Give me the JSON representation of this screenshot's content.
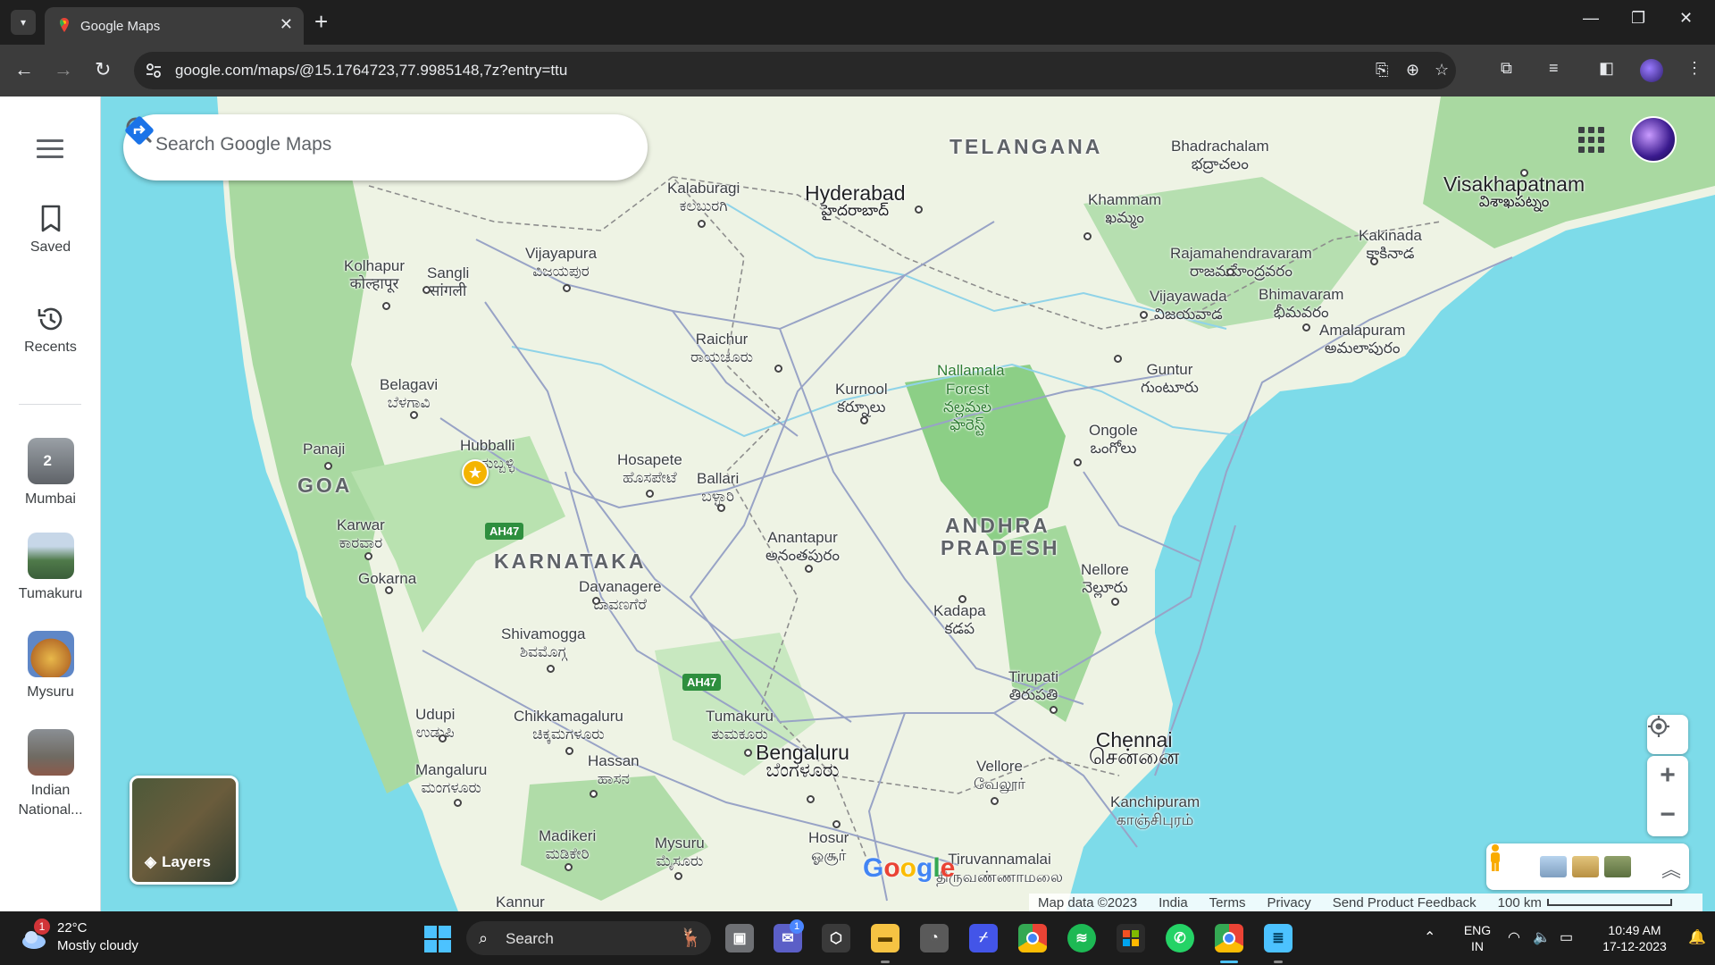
{
  "browser": {
    "tab_title": "Google Maps",
    "url": "google.com/maps/@15.1764723,77.9985148,7z?entry=ttu"
  },
  "sidebar": {
    "saved": "Saved",
    "recents": "Recents",
    "recent_places": [
      {
        "label": "Mumbai",
        "badge": "2"
      },
      {
        "label": "Tumakuru"
      },
      {
        "label": "Mysuru"
      },
      {
        "label": "Indian National..."
      }
    ]
  },
  "search": {
    "placeholder": "Search Google Maps"
  },
  "map": {
    "states": [
      "TELANGANA",
      "KARNATAKA",
      "ANDHRA",
      "PRADESH",
      "GOA"
    ],
    "places": [
      {
        "name": "Hyderabad",
        "local": "హైదరాబాద్"
      },
      {
        "name": "Kalaburagi",
        "local": "ಕಲಬುರಗಿ"
      },
      {
        "name": "Vijayapura",
        "local": "ವಿಜಯಪುರ"
      },
      {
        "name": "Kolhapur",
        "local": "कोल्हापूर"
      },
      {
        "name": "Sangli",
        "local": "सांगली"
      },
      {
        "name": "Belagavi",
        "local": "ಬೆಳಗಾವಿ"
      },
      {
        "name": "Panaji",
        "local": ""
      },
      {
        "name": "Hubballi",
        "local": "ಹುಬ್ಬಳ್ಳಿ"
      },
      {
        "name": "Karwar",
        "local": "ಕಾರವಾರ"
      },
      {
        "name": "Gokarna",
        "local": ""
      },
      {
        "name": "Raichur",
        "local": "ರಾಯಚೂರು"
      },
      {
        "name": "Hosapete",
        "local": "ಹೊಸಪೇಟೆ"
      },
      {
        "name": "Ballari",
        "local": "ಬಳ್ಳಾರಿ"
      },
      {
        "name": "Kurnool",
        "local": "కర్నూలు"
      },
      {
        "name": "Nallamala",
        "local": ""
      },
      {
        "name": "Forest",
        "local": "నల్లమల ఫారెస్ట్"
      },
      {
        "name": "Anantapur",
        "local": "అనంతపురం"
      },
      {
        "name": "Davanagere",
        "local": "ದಾವಣಗೆರೆ"
      },
      {
        "name": "Shivamogga",
        "local": "ಶಿವಮೊಗ್ಗ"
      },
      {
        "name": "Udupi",
        "local": "ಉಡುಪಿ"
      },
      {
        "name": "Chikkamagaluru",
        "local": "ಚಿಕ್ಕಮಗಳೂರು"
      },
      {
        "name": "Tumakuru",
        "local": "ತುಮಕೂರು"
      },
      {
        "name": "Bengaluru",
        "local": "ಬೆಂಗಳೂರು"
      },
      {
        "name": "Hassan",
        "local": "ಹಾಸನ"
      },
      {
        "name": "Mangaluru",
        "local": "ಮಂಗಳೂರು"
      },
      {
        "name": "Madikeri",
        "local": "ಮಡಿಕೇರಿ"
      },
      {
        "name": "Mysuru",
        "local": "ಮೈಸೂರು"
      },
      {
        "name": "Hosur",
        "local": "ஓசூர்"
      },
      {
        "name": "Kannur",
        "local": ""
      },
      {
        "name": "Tiruvannamalai",
        "local": "திருவண்ணாமலை"
      },
      {
        "name": "Vellore",
        "local": "வேலூர்"
      },
      {
        "name": "Chennai",
        "local": "சென்னை"
      },
      {
        "name": "Kanchipuram",
        "local": "காஞ்சிபுரம்"
      },
      {
        "name": "Tirupati",
        "local": "తిరుపతి"
      },
      {
        "name": "Kadapa",
        "local": "కడప"
      },
      {
        "name": "Nellore",
        "local": "నెల్లూరు"
      },
      {
        "name": "Ongole",
        "local": "ఒంగోలు"
      },
      {
        "name": "Guntur",
        "local": "గుంటూరు"
      },
      {
        "name": "Vijayawada",
        "local": "విజయవాడ"
      },
      {
        "name": "Khammam",
        "local": "ఖమ్మం"
      },
      {
        "name": "Bhadrachalam",
        "local": "భద్రాచలం"
      },
      {
        "name": "Rajamahendravaram",
        "local": "రాజమహేంద్రవరం"
      },
      {
        "name": "Bhimavaram",
        "local": "భీమవరం"
      },
      {
        "name": "Amalapuram",
        "local": "అమలాపురం"
      },
      {
        "name": "Kakinada",
        "local": "కాకినాడ"
      },
      {
        "name": "Visakhapatnam",
        "local": "విశాఖపట్నం"
      }
    ],
    "highways": [
      "AH47",
      "AH47"
    ],
    "layers_label": "Layers",
    "logo": "Google"
  },
  "footer": {
    "map_data": "Map data ©2023",
    "region": "India",
    "terms": "Terms",
    "privacy": "Privacy",
    "feedback": "Send Product Feedback",
    "scale": "100 km"
  },
  "taskbar": {
    "temp": "22°C",
    "weather": "Mostly cloudy",
    "weather_badge": "1",
    "search_label": "Search",
    "lang": "ENG",
    "region": "IN",
    "time": "10:49 AM",
    "date": "17-12-2023",
    "teams_badge": "1"
  },
  "colors": {
    "water": "#7ddbe9",
    "land": "#f5f1e6",
    "forest": "#a8d5a2",
    "road": "#9aa6c8",
    "accent": "#1a73e8"
  }
}
